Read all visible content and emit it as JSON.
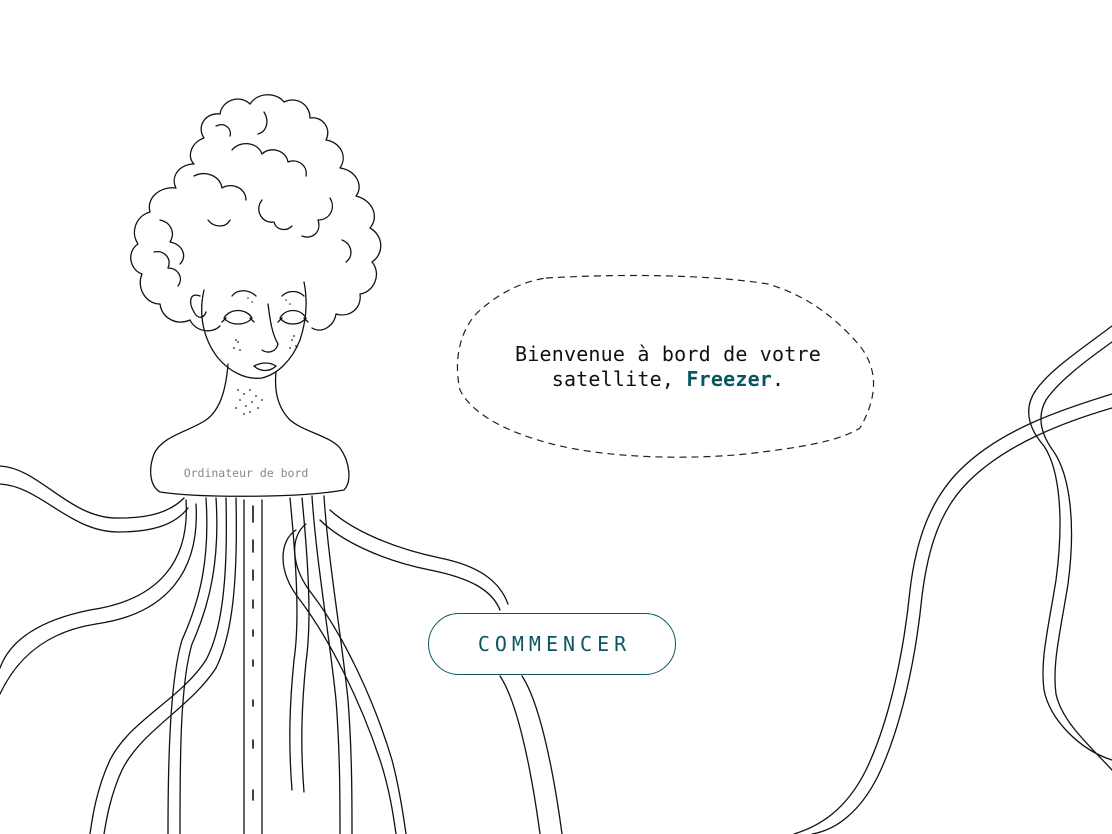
{
  "onboarding": {
    "greeting_prefix": "Bienvenue à bord de votre satellite, ",
    "brand_name": "Freezer",
    "greeting_suffix": ".",
    "computer_label": "Ordinateur de bord",
    "start_button_label": "COMMENCER"
  },
  "colors": {
    "accent": "#0b5563",
    "ink": "#111111",
    "muted_label": "#888888",
    "background": "#ffffff"
  },
  "icons": {
    "illustration": "onboard-computer-woman-illustration",
    "speech_bubble": "dashed-speech-bubble"
  }
}
